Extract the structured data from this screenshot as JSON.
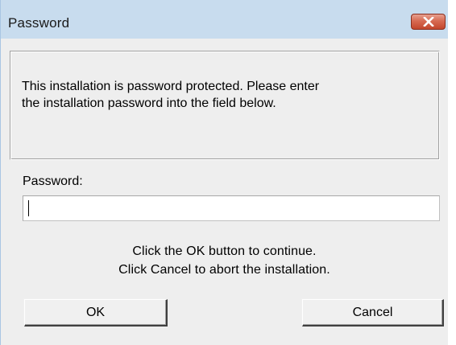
{
  "window": {
    "title": "Password"
  },
  "info": {
    "line1": "This installation is password protected. Please enter",
    "line2": "the installation password into the field below."
  },
  "password": {
    "label": "Password:",
    "value": ""
  },
  "hints": {
    "line1": "Click the OK button to continue.",
    "line2": "Click Cancel to abort the installation."
  },
  "buttons": {
    "ok": "OK",
    "cancel": "Cancel"
  },
  "icons": {
    "close": "close-icon"
  },
  "colors": {
    "titlebar": "#c8dcee",
    "close_button": "#c3472d",
    "dialog_background": "#eeeeee"
  }
}
